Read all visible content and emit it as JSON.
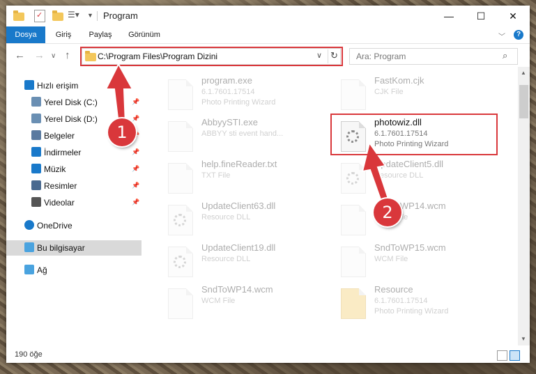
{
  "window": {
    "title": "Program",
    "controls": {
      "minimize": "—",
      "maximize": "☐",
      "close": "✕"
    }
  },
  "ribbon": {
    "tabs": [
      "Dosya",
      "Giriş",
      "Paylaş",
      "Görünüm"
    ],
    "help": "?"
  },
  "address": {
    "path": "C:\\Program Files\\Program Dizini",
    "search_placeholder": "Ara: Program"
  },
  "sidebar": {
    "items": [
      {
        "label": "Hızlı erişim",
        "icon": "star-icon",
        "pinned": false
      },
      {
        "label": "Yerel Disk (C:)",
        "icon": "drive-icon",
        "pinned": true
      },
      {
        "label": "Yerel Disk (D:)",
        "icon": "drive-icon",
        "pinned": true
      },
      {
        "label": "Belgeler",
        "icon": "documents-icon",
        "pinned": true
      },
      {
        "label": "İndirmeler",
        "icon": "download-icon",
        "pinned": true
      },
      {
        "label": "Müzik",
        "icon": "music-icon",
        "pinned": true
      },
      {
        "label": "Resimler",
        "icon": "pictures-icon",
        "pinned": true
      },
      {
        "label": "Videolar",
        "icon": "video-icon",
        "pinned": true
      },
      {
        "label": "OneDrive",
        "icon": "cloud-icon",
        "pinned": false
      },
      {
        "label": "Bu bilgisayar",
        "icon": "computer-icon",
        "pinned": false
      },
      {
        "label": "Ağ",
        "icon": "network-icon",
        "pinned": false
      }
    ]
  },
  "files": [
    {
      "name": "program.exe",
      "line2": "6.1.7601.17514",
      "line3": "Photo Printing Wizard",
      "faded": true
    },
    {
      "name": "FastKom.cjk",
      "line2": "CJK File",
      "line3": "",
      "faded": true
    },
    {
      "name": "AbbyySTI.exe",
      "line2": "ABBYY sti event hand...",
      "line3": "",
      "faded": true
    },
    {
      "name": "photowiz.dll",
      "line2": "6.1.7601.17514",
      "line3": "Photo Printing Wizard",
      "faded": false
    },
    {
      "name": "help.fineReader.txt",
      "line2": "TXT File",
      "line3": "",
      "faded": true
    },
    {
      "name": "UpdateClient5.dll",
      "line2": "Resource DLL",
      "line3": "",
      "faded": true
    },
    {
      "name": "UpdateClient63.dll",
      "line2": "Resource DLL",
      "line3": "",
      "faded": true
    },
    {
      "name": "SndToWP14.wcm",
      "line2": "WCM File",
      "line3": "",
      "faded": true
    },
    {
      "name": "UpdateClient19.dll",
      "line2": "Resource DLL",
      "line3": "",
      "faded": true
    },
    {
      "name": "SndToWP15.wcm",
      "line2": "WCM File",
      "line3": "",
      "faded": true
    },
    {
      "name": "SndToWP14.wcm",
      "line2": "WCM File",
      "line3": "",
      "faded": true
    },
    {
      "name": "Resource",
      "line2": "6.1.7601.17514",
      "line3": "Photo Printing Wizard",
      "faded": true
    }
  ],
  "status": {
    "count": "190 öğe"
  },
  "annotations": {
    "step1": "1",
    "step2": "2",
    "color": "#d9373b"
  }
}
